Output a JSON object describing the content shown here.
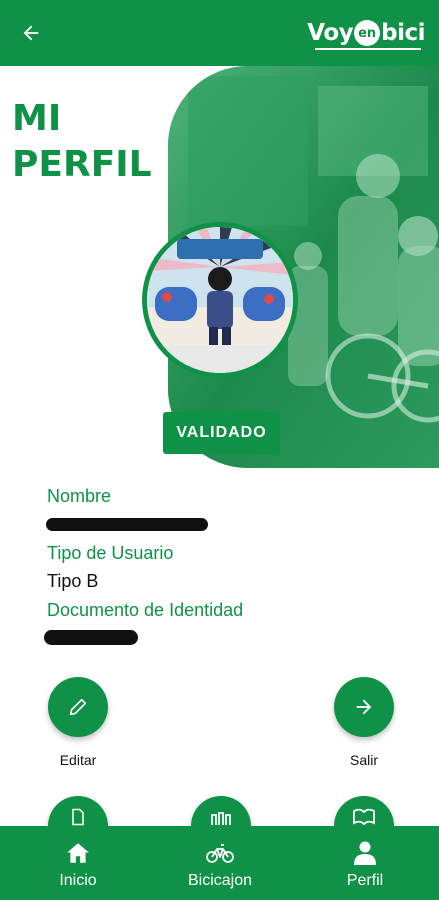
{
  "header": {
    "back_icon": "arrow-left-icon",
    "logo": {
      "part1": "Voy",
      "part2": "en",
      "part3": "bici"
    }
  },
  "page": {
    "title_line1": "MI",
    "title_line2": "PERFIL"
  },
  "profile": {
    "status": "VALIDADO",
    "fields": [
      {
        "label": "Nombre",
        "value": ""
      },
      {
        "label": "Tipo de Usuario",
        "value": "Tipo B"
      },
      {
        "label": "Documento de Identidad",
        "value": ""
      }
    ]
  },
  "actions": [
    {
      "label": "Editar",
      "icon": "pencil-icon"
    },
    {
      "label": "Salir",
      "icon": "arrow-right-icon"
    }
  ],
  "actions_row2_icons": [
    "document-icon",
    "bike-rack-icon",
    "book-icon"
  ],
  "bottom_nav": {
    "items": [
      {
        "label": "Inicio",
        "icon": "home-icon"
      },
      {
        "label": "Bicicajon",
        "icon": "bicycle-icon"
      },
      {
        "label": "Perfil",
        "icon": "person-icon"
      }
    ]
  },
  "colors": {
    "primary": "#0f9247",
    "white": "#ffffff",
    "text": "#111111"
  }
}
